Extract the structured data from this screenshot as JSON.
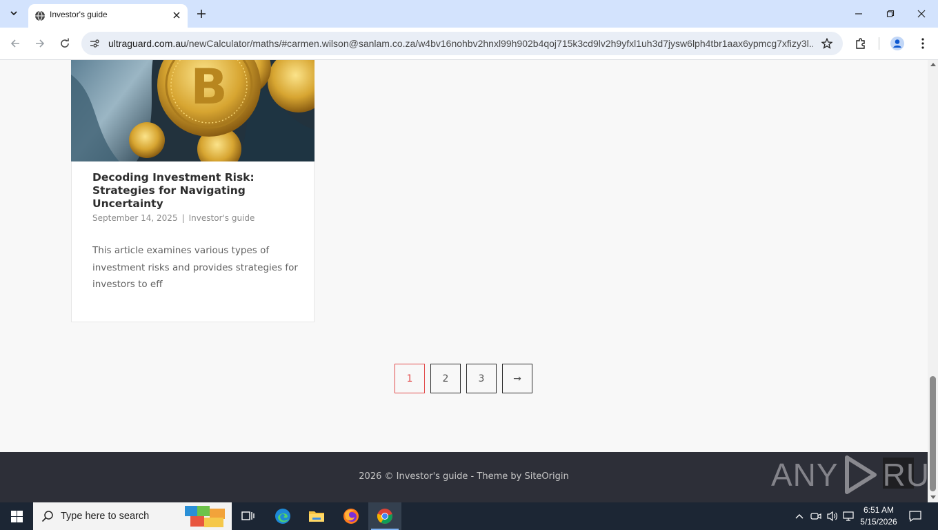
{
  "browser": {
    "tab": {
      "title": "Investor's guide"
    },
    "url": {
      "domain": "ultraguard.com.au",
      "path": "/newCalculator/maths/#carmen.wilson@sanlam.co.za/w4bv16nohbv2hnxl99h902b4qoj715k3cd9lv2h9yfxl1uh3d7jysw6lph4tbr1aax6ypmcg7xfizy3l..."
    }
  },
  "post": {
    "title": "Decoding Investment Risk: Strategies for Navigating Uncertainty",
    "date": "September 14, 2025",
    "separator": "|",
    "category": "Investor's guide",
    "excerpt": "This article examines various types of investment risks and provides strategies for investors to eff"
  },
  "pagination": {
    "pages": [
      "1",
      "2",
      "3"
    ],
    "current": 1,
    "next_label": "→"
  },
  "footer": {
    "copyright": "2026 © Investor's guide",
    "dash": "-",
    "theme_prefix": "Theme by",
    "theme_link": "SiteOrigin"
  },
  "watermark": {
    "left": "ANY",
    "right": "RUN"
  },
  "taskbar": {
    "search_placeholder": "Type here to search",
    "time": "6:51 AM",
    "date": "5/15/2026"
  },
  "colors": {
    "tab_strip": "#d3e3fd",
    "accent_red": "#e24b4b",
    "footer_bg": "#2d2f38",
    "taskbar_bg": "#1c2634"
  }
}
